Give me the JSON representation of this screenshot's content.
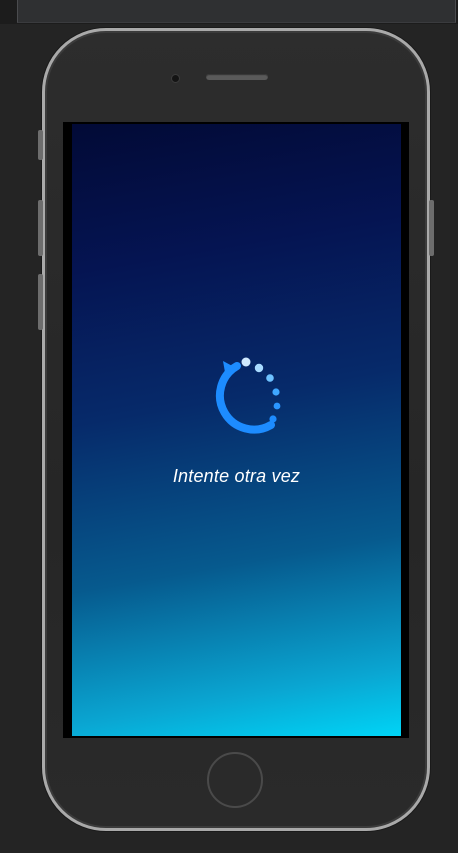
{
  "status": {
    "message": "Intente otra vez"
  },
  "icons": {
    "refresh": "refresh-loading-icon"
  },
  "colors": {
    "accent": "#1d8cff",
    "dots": "#8fd1ff",
    "screen_top": "#020a36",
    "screen_bottom": "#00d4f6"
  }
}
